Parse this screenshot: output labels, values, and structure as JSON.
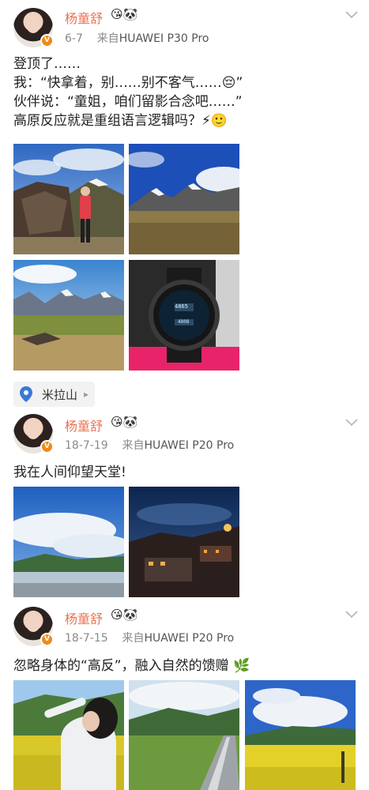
{
  "posts": [
    {
      "author": "杨童舒",
      "date": "6-7",
      "source_prefix": "来自",
      "device": "HUAWEI P30 Pro",
      "text_lines": [
        "登顶了……",
        "我：“快拿着，别……别不客气……😔”",
        "伙伴说：“童姐，咱们留影合念吧……”",
        "高原反应就是重组语言逻辑吗？⚡🙂"
      ],
      "images": [
        "photo-rock-mountain",
        "photo-snow-peaks",
        "photo-valley",
        "photo-smartwatch"
      ]
    },
    {
      "author": "杨童舒",
      "date": "18-7-19",
      "source_prefix": "来自",
      "device": "HUAWEI P20 Pro",
      "text_lines": [
        "我在人间仰望天堂!"
      ],
      "images": [
        "photo-blue-sky-river",
        "photo-night-village"
      ]
    },
    {
      "author": "杨童舒",
      "date": "18-7-15",
      "source_prefix": "来自",
      "device": "HUAWEI P20 Pro",
      "text_lines": [
        "忽略身体的“高反”，融入自然的馈赠 🌿"
      ],
      "images": [
        "photo-woman-flowers",
        "photo-road-hills",
        "photo-yellow-field"
      ]
    }
  ],
  "location": {
    "label": "米拉山"
  },
  "name_icons": "😘🐼",
  "watch": {
    "reading1": "4865",
    "reading2": "4808"
  },
  "colors": {
    "name": "#eb7350",
    "meta": "#8a8a8a",
    "badge": "#f08a1a"
  }
}
